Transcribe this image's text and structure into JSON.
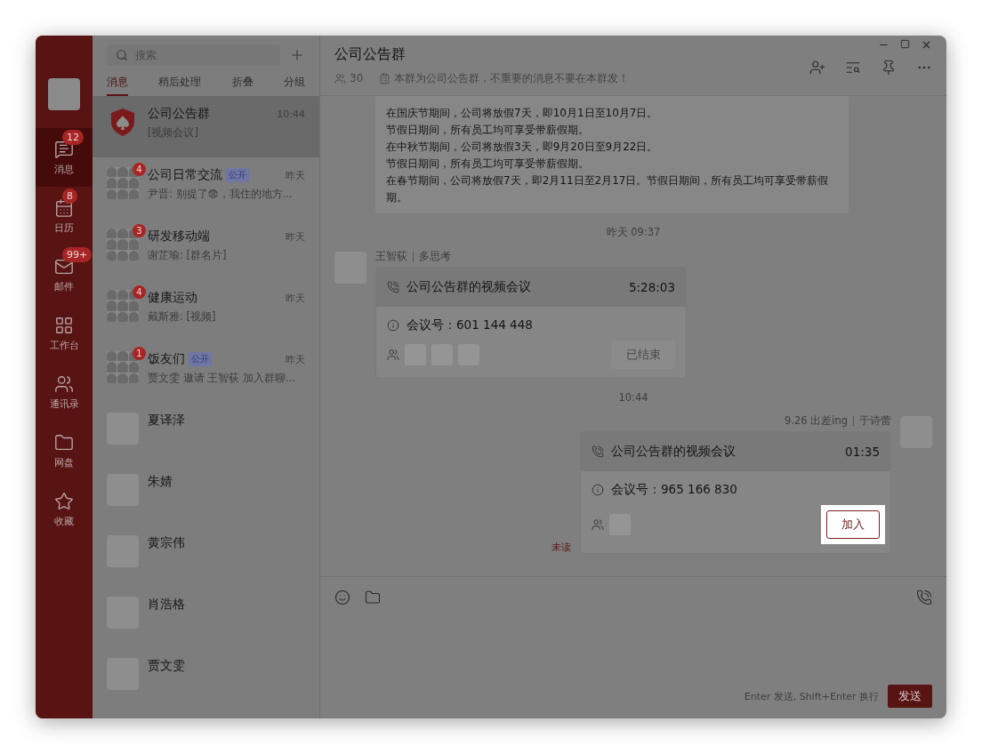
{
  "rail": {
    "items": [
      {
        "kind": "messages",
        "label": "消息",
        "badge": "12",
        "selected": true
      },
      {
        "kind": "calendar",
        "label": "日历",
        "badge": "8",
        "selected": false
      },
      {
        "kind": "mail",
        "label": "邮件",
        "badge": "99+",
        "selected": false
      },
      {
        "kind": "apps",
        "label": "工作台",
        "selected": false
      },
      {
        "kind": "contacts",
        "label": "通讯录",
        "selected": false
      },
      {
        "kind": "drive",
        "label": "网盘",
        "selected": false
      },
      {
        "kind": "favorites",
        "label": "收藏",
        "selected": false
      }
    ]
  },
  "search": {
    "placeholder": "搜索"
  },
  "list_tabs": [
    {
      "label": "消息",
      "selected": true
    },
    {
      "label": "稍后处理",
      "selected": false
    },
    {
      "label": "折叠",
      "selected": false
    },
    {
      "label": "分组",
      "selected": false
    }
  ],
  "conversations": [
    {
      "kind": "official",
      "name": "公司公告群",
      "time": "10:44",
      "preview": "[视频会议]",
      "selected": true
    },
    {
      "kind": "group",
      "name": "公司日常交流",
      "tag": "公开",
      "time": "昨天",
      "preview": "尹晋: 别提了😨，我住的地方...",
      "badge": "4",
      "selected": false
    },
    {
      "kind": "group",
      "name": "研发移动端",
      "time": "昨天",
      "preview": "谢芷瑜: [群名片]",
      "badge": "3",
      "selected": false
    },
    {
      "kind": "group",
      "name": "健康运动",
      "time": "昨天",
      "preview": "戴斯雅: [视频]",
      "badge": "4",
      "selected": false
    },
    {
      "kind": "group",
      "name": "饭友们",
      "tag": "公开",
      "time": "昨天",
      "preview": "贾文雯 邀请 王智荻 加入群聊...",
      "badge": "1",
      "selected": false
    },
    {
      "kind": "person",
      "name": "夏译泽",
      "selected": false
    },
    {
      "kind": "person",
      "name": "朱婧",
      "selected": false
    },
    {
      "kind": "person",
      "name": "黄宗伟",
      "selected": false
    },
    {
      "kind": "person",
      "name": "肖浩格",
      "selected": false
    },
    {
      "kind": "person",
      "name": "贾文雯",
      "selected": false
    }
  ],
  "chat": {
    "title": "公司公告群",
    "member_count": "30",
    "notice": "本群为公司公告群，不重要的消息不要在本群发！",
    "messages": [
      {
        "kind": "text",
        "lines": [
          "在国庆节期间，公司将放假7天，即10月1日至10月7日。",
          "节假日期间，所有员工均可享受带薪假期。",
          "在中秋节期间，公司将放假3天，即9月20日至9月22日。",
          "节假日期间，所有员工均可享受带薪假期。",
          "在春节期间，公司将放假7天，即2月11日至2月17日。节假日期间，所有员工均可享受带薪假期。"
        ]
      },
      {
        "kind": "time",
        "text": "昨天 09:37"
      },
      {
        "kind": "meeting",
        "own": false,
        "sender": "王智荻",
        "status": "多思考",
        "title": "公司公告群的视频会议",
        "duration": "5:28:03",
        "id_label": "会议号：",
        "id": "601 144 448",
        "participants": [
          {
            "kind": "avatar"
          },
          {
            "kind": "avatar"
          },
          {
            "kind": "avatar"
          }
        ],
        "action": {
          "label": "已结束",
          "disabled": true,
          "highlighted": false
        }
      },
      {
        "kind": "time",
        "text": "10:44"
      },
      {
        "kind": "meeting",
        "own": true,
        "sender": "于诗蕾",
        "status": "9.26 出差ing",
        "read_status": "未读",
        "title": "公司公告群的视频会议",
        "duration": "01:35",
        "id_label": "会议号：",
        "id": "965 166 830",
        "participants": [
          {
            "kind": "avatar"
          }
        ],
        "action": {
          "label": "加入",
          "disabled": false,
          "highlighted": true
        }
      }
    ],
    "input_hint": "Enter 发送, Shift+Enter 换行",
    "send": "发送"
  }
}
